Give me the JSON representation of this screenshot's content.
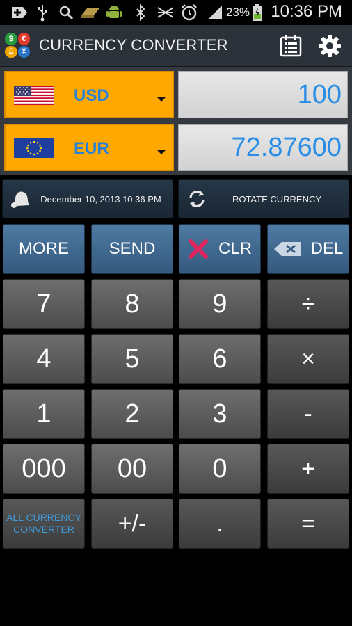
{
  "status_bar": {
    "battery_percent": "23%",
    "time": "10:36 PM",
    "icons": [
      "add-icon",
      "usb-icon",
      "search-icon",
      "storage-icon",
      "android-icon",
      "bluetooth-icon",
      "mute-icon",
      "alarm-icon",
      "signal-icon",
      "battery-icon"
    ]
  },
  "app": {
    "title": "CURRENCY CONVERTER",
    "logo_symbols": [
      "$",
      "€",
      "£",
      "¥"
    ],
    "actions": [
      "list-icon",
      "settings-icon"
    ]
  },
  "from_currency": {
    "code": "USD",
    "amount": "100",
    "flag": "us-flag-icon"
  },
  "to_currency": {
    "code": "EUR",
    "amount": "72.87600",
    "flag": "eu-flag-icon"
  },
  "tools": {
    "date_label": "December 10, 2013 10:36 PM",
    "rotate_label": "ROTATE CURRENCY"
  },
  "keypad": {
    "more": "MORE",
    "send": "SEND",
    "clear": "CLR",
    "delete": "DEL",
    "k7": "7",
    "k8": "8",
    "k9": "9",
    "divide": "÷",
    "k4": "4",
    "k5": "5",
    "k6": "6",
    "multiply": "×",
    "k1": "1",
    "k2": "2",
    "k3": "3",
    "minus": "-",
    "k000": "000",
    "k00": "00",
    "k0": "0",
    "plus": "+",
    "all_currency_line1": "ALL CURRENCY",
    "all_currency_line2": "CONVERTER",
    "plusminus": "+/-",
    "dot": ".",
    "equals": "="
  },
  "colors": {
    "accent_orange": "#ffa800",
    "amount_blue": "#2a8ee6",
    "code_blue": "#2a82d6",
    "key_blue": "#4f7aa3",
    "clear_red": "#e0245e"
  }
}
